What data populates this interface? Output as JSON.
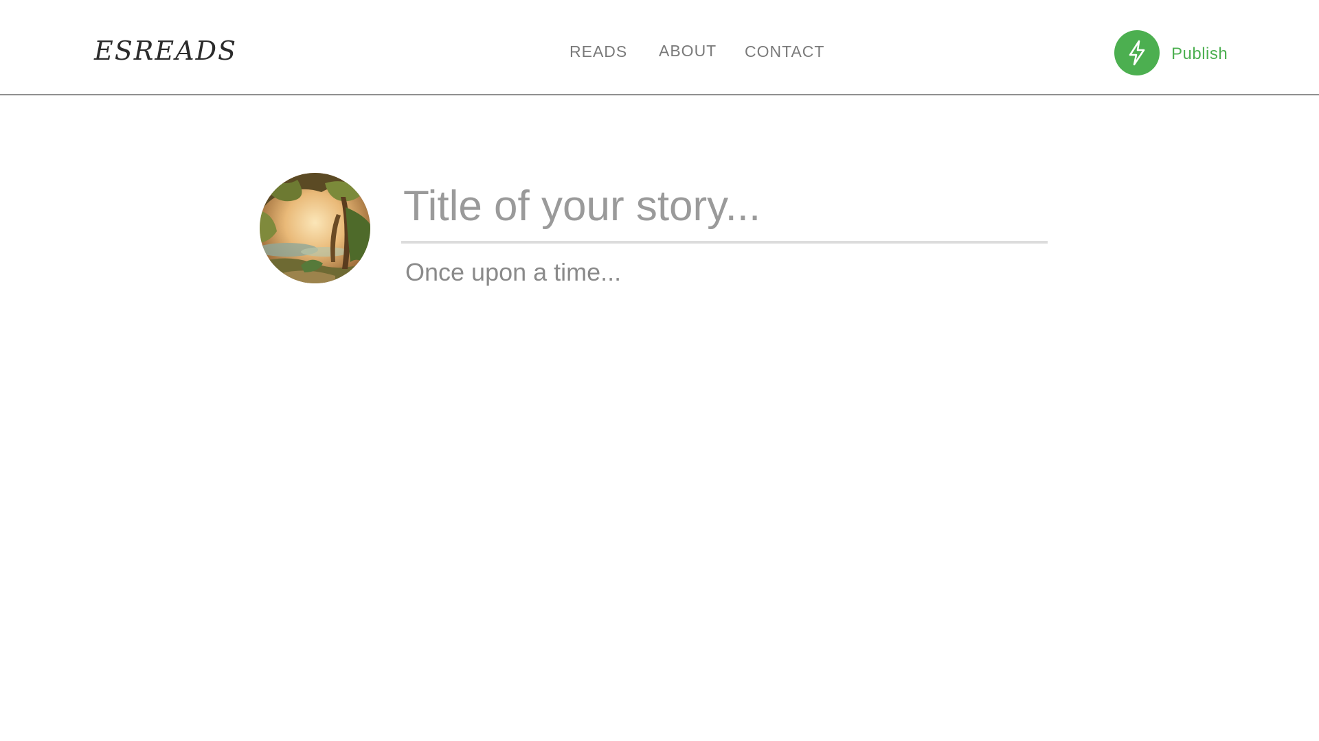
{
  "header": {
    "logo": "ESREADS",
    "nav": [
      {
        "label": "READS"
      },
      {
        "label": "ABOUT"
      },
      {
        "label": "CONTACT"
      }
    ],
    "publish": {
      "label": "Publish",
      "icon": "lightning-bolt-icon"
    }
  },
  "editor": {
    "avatar": "landscape-painting-avatar",
    "title": {
      "value": "",
      "placeholder": "Title of your story..."
    },
    "body": {
      "value": "",
      "placeholder": "Once upon a time..."
    }
  },
  "colors": {
    "accent": "#4caf50",
    "nav_text": "#7a7a7a",
    "logo_text": "#2b2b2b",
    "header_border": "#8f8f8f",
    "title_underline": "#dcdcdc"
  }
}
